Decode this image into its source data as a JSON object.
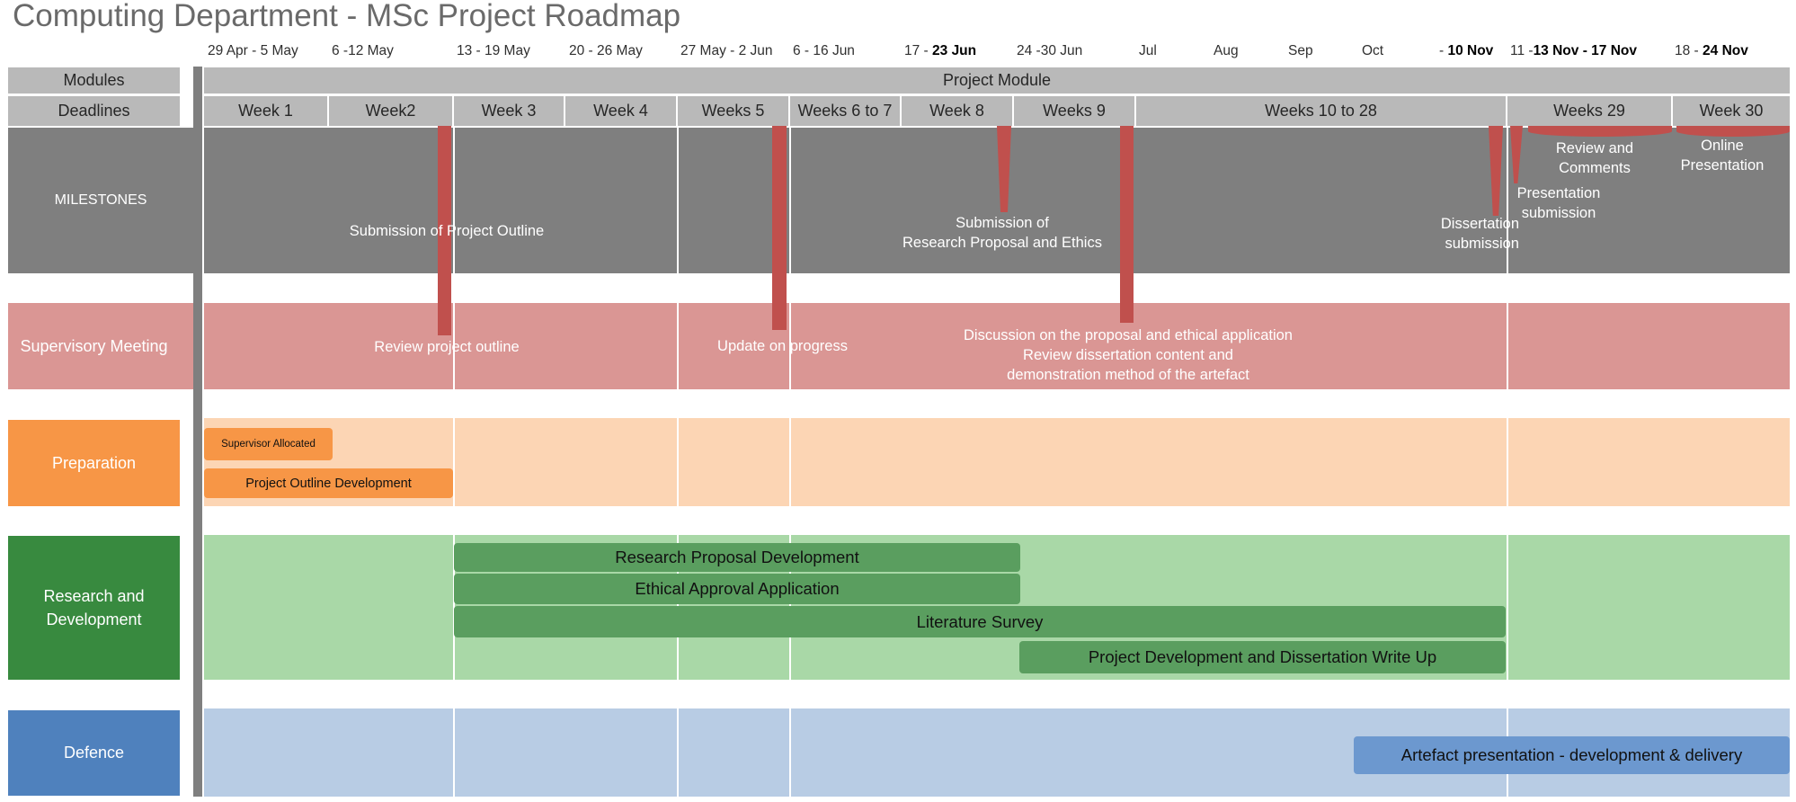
{
  "title": "Computing Department - MSc Project Roadmap",
  "dates": [
    {
      "pre": "29 Apr - 5 May",
      "bold": ""
    },
    {
      "pre": "6 -12 May",
      "bold": ""
    },
    {
      "pre": "13 - 19 May",
      "bold": ""
    },
    {
      "pre": "20 - 26 May",
      "bold": ""
    },
    {
      "pre": "27 May - 2 Jun",
      "bold": ""
    },
    {
      "pre": "6 - 16 Jun",
      "bold": ""
    },
    {
      "pre": "17 - ",
      "bold": "23 Jun"
    },
    {
      "pre": "24 -30 Jun",
      "bold": ""
    },
    {
      "pre": "Jul",
      "bold": ""
    },
    {
      "pre": "Aug",
      "bold": ""
    },
    {
      "pre": "Sep",
      "bold": ""
    },
    {
      "pre": "Oct",
      "bold": ""
    },
    {
      "pre": "- ",
      "bold": "10 Nov"
    },
    {
      "pre": "11 -",
      "bold": "13 Nov  - 17 Nov"
    },
    {
      "pre": "18 - ",
      "bold": "24 Nov"
    }
  ],
  "rows": {
    "modules": "Modules",
    "deadlines": "Deadlines",
    "milestones": "MILESTONES",
    "supervisory": "Supervisory Meeting",
    "preparation": "Preparation",
    "research": "Research and\nDevelopment",
    "defence": "Defence"
  },
  "project_module": "Project Module",
  "weeks": [
    "Week 1",
    "Week2",
    "Week 3",
    "Week 4",
    "Weeks 5",
    "Weeks 6 to 7",
    "Week 8",
    "Weeks 9",
    "Weeks 10 to 28",
    "Weeks 29",
    "Week 30"
  ],
  "milestones": {
    "outline": "Submission of Project Outline",
    "proposal": "Submission of\nResearch Proposal and Ethics",
    "dissertation": "Dissertation\nsubmission",
    "presentation_sub": "Presentation\nsubmission",
    "review": "Review and\nComments",
    "online": "Online\nPresentation"
  },
  "meetings": {
    "outline": "Review project outline",
    "progress": "Update on progress",
    "discussion": "Discussion on the proposal and ethical application\nReview dissertation content and\ndemonstration method of the artefact"
  },
  "tasks": {
    "supervisor": "Supervisor Allocated",
    "outline_dev": "Project Outline Development",
    "research_proposal": "Research Proposal Development",
    "ethical": "Ethical Approval Application",
    "literature": "Literature Survey",
    "project_dev": "Project Development and Dissertation Write Up",
    "artefact": "Artefact presentation - development & delivery"
  },
  "colors": {
    "milestone_band": "#7f7f7f",
    "marker_red": "#c0504d",
    "supervisory": "#da9694",
    "preparation_label": "#f79646",
    "preparation_band": "#fcd5b4",
    "research_label": "#388a3f",
    "research_band": "#a9d8a7",
    "research_bar": "#5a9e5f",
    "defence_label": "#4f81bd",
    "defence_band": "#b8cce4",
    "defence_bar": "#6c98cf",
    "header_gray": "#b9b9b9"
  }
}
